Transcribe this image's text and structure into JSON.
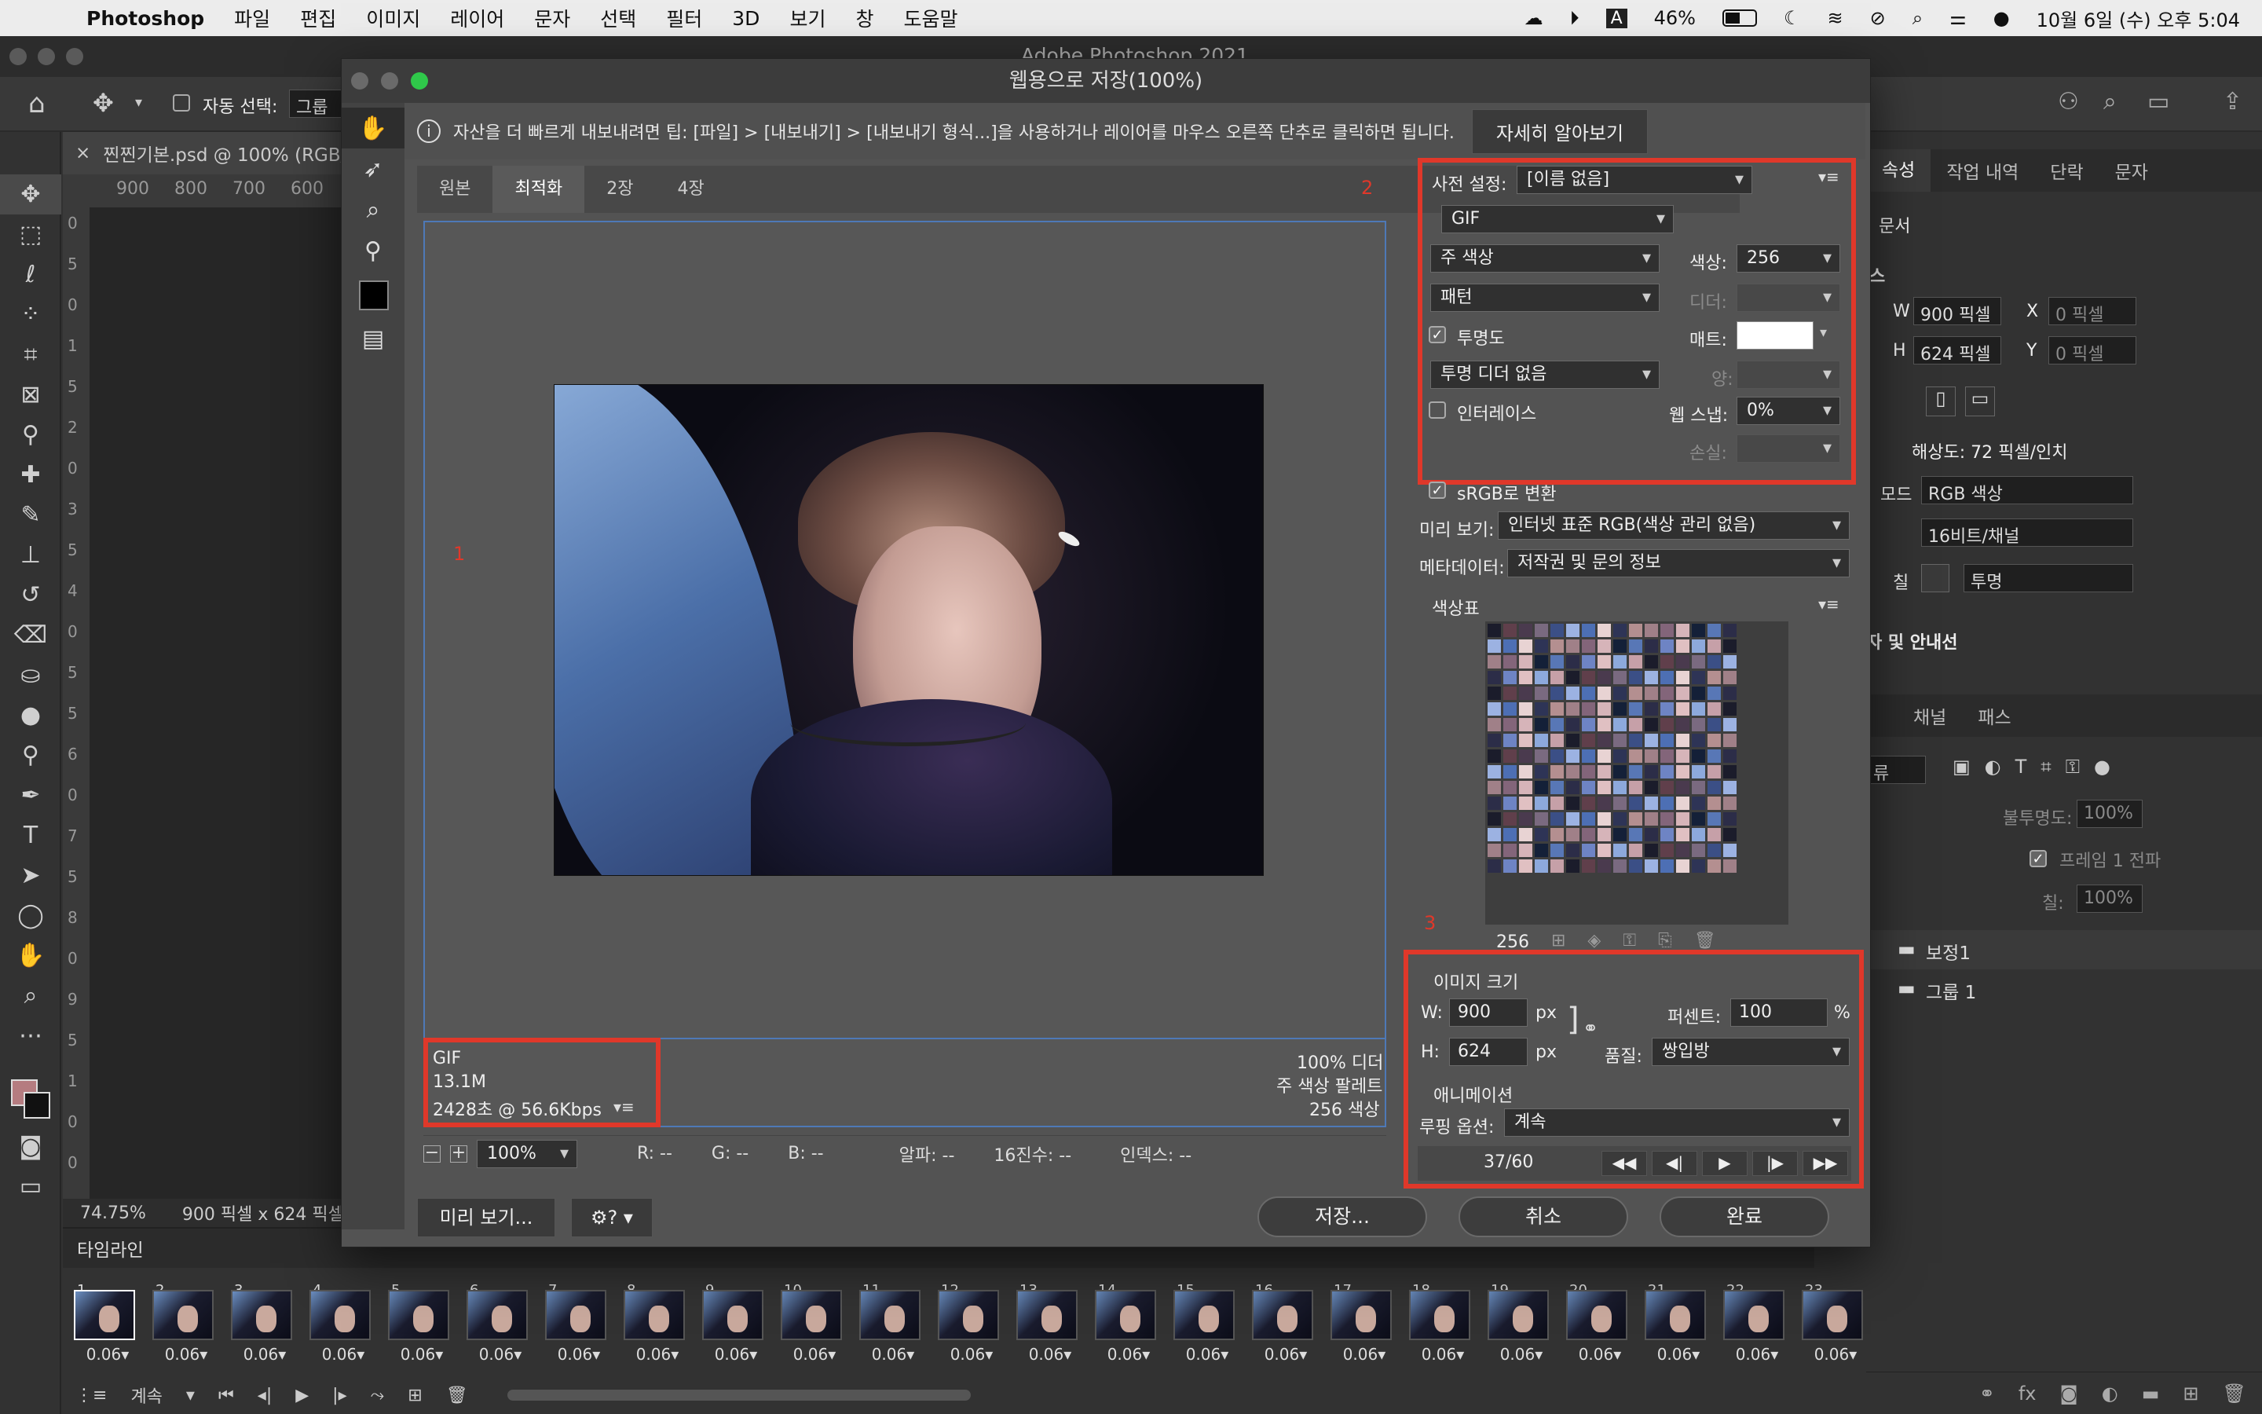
{
  "menubar": {
    "app": "Photoshop",
    "items": [
      "파일",
      "편집",
      "이미지",
      "레이어",
      "문자",
      "선택",
      "필터",
      "3D",
      "보기",
      "창",
      "도움말"
    ],
    "battery": "46%",
    "datetime": "10월 6일 (수) 오후 5:04",
    "input_icon": "A"
  },
  "ps": {
    "window_title": "Adobe Photoshop 2021",
    "options": {
      "auto_select": "자동 선택:",
      "auto_select_value": "그룹"
    },
    "doc_tab": "찐찐기본.psd @ 100% (RGB/",
    "ruler_marks": [
      "900",
      "800",
      "700",
      "600"
    ],
    "vruler_marks": [
      "0",
      "5",
      "0",
      "1",
      "5",
      "2",
      "0",
      "3",
      "5",
      "4",
      "0",
      "5",
      "5",
      "6",
      "0",
      "7",
      "5",
      "8",
      "0",
      "9",
      "5",
      "1",
      "0",
      "0"
    ],
    "status": {
      "zoom": "74.75%",
      "size": "900 픽셀 x 624 픽셀"
    }
  },
  "right_panel": {
    "tabs": [
      "속성",
      "작업 내역",
      "단락",
      "문자"
    ],
    "doc_label": "문서",
    "canvas_label": "스",
    "w_label": "W",
    "w_value": "900 픽셀",
    "x_label": "X",
    "x_value": "0 픽셀",
    "h_label": "H",
    "h_value": "624 픽셀",
    "y_label": "Y",
    "y_value": "0 픽셀",
    "resolution": "해상도: 72 픽셀/인치",
    "mode_label": "모드",
    "mode_value": "RGB 색상",
    "depth_value": "16비트/채널",
    "fill_label": "칠",
    "fill_value": "투명",
    "guides": "자 및 안내선",
    "layers_tabs": [
      "채널",
      "패스"
    ],
    "kind": "류",
    "opacity_label": "불투명도:",
    "opacity_value": "100%",
    "frame_label": "프레임 1 전파",
    "fill2_label": "칠:",
    "fill2_value": "100%",
    "layers": [
      "보정1",
      "그룹 1"
    ]
  },
  "timeline": {
    "title": "타임라인",
    "frames": [
      {
        "n": "1",
        "d": "0.06"
      },
      {
        "n": "2",
        "d": "0.06"
      },
      {
        "n": "3",
        "d": "0.06"
      },
      {
        "n": "4",
        "d": "0.06"
      },
      {
        "n": "5",
        "d": "0.06"
      },
      {
        "n": "6",
        "d": "0.06"
      },
      {
        "n": "7",
        "d": "0.06"
      },
      {
        "n": "8",
        "d": "0.06"
      },
      {
        "n": "9",
        "d": "0.06"
      },
      {
        "n": "10",
        "d": "0.06"
      },
      {
        "n": "11",
        "d": "0.06"
      },
      {
        "n": "12",
        "d": "0.06"
      },
      {
        "n": "13",
        "d": "0.06"
      },
      {
        "n": "14",
        "d": "0.06"
      },
      {
        "n": "15",
        "d": "0.06"
      },
      {
        "n": "16",
        "d": "0.06"
      },
      {
        "n": "17",
        "d": "0.06"
      },
      {
        "n": "18",
        "d": "0.06"
      },
      {
        "n": "19",
        "d": "0.06"
      },
      {
        "n": "20",
        "d": "0.06"
      },
      {
        "n": "21",
        "d": "0.06"
      },
      {
        "n": "22",
        "d": "0.06"
      },
      {
        "n": "23",
        "d": "0.06"
      }
    ],
    "loop": "계속"
  },
  "dialog": {
    "title": "웹용으로 저장(100%)",
    "tip": "자산을 더 빠르게 내보내려면 팁: [파일] > [내보내기] > [내보내기 형식...]을 사용하거나 레이어를 마우스 오른쪽 단추로 클릭하면 됩니다.",
    "learn_more": "자세히 알아보기",
    "view_tabs": [
      "원본",
      "최적화",
      "2장",
      "4장"
    ],
    "annot": {
      "a1": "1",
      "a2": "2",
      "a3": "3"
    },
    "info_left": {
      "format": "GIF",
      "size": "13.1M",
      "time": "2428초 @ 56.6Kbps"
    },
    "info_right": {
      "dither": "100% 디더",
      "palette": "주 색상 팔레트",
      "colors": "256 색상"
    },
    "zoom": "100%",
    "readout": {
      "r": "R: --",
      "g": "G: --",
      "b": "B: --",
      "alpha": "알파: --",
      "hex": "16진수: --",
      "index": "인덱스: --"
    },
    "preview_btn": "미리 보기...",
    "save_btn": "저장...",
    "cancel_btn": "취소",
    "done_btn": "완료",
    "settings": {
      "preset_label": "사전 설정:",
      "preset_value": "[이름 없음]",
      "format": "GIF",
      "reduction": "주 색상",
      "colors_label": "색상:",
      "colors_value": "256",
      "dither_algo": "패턴",
      "dither_label": "디더:",
      "transparency": "투명도",
      "matte_label": "매트:",
      "trans_dither": "투명 디더 없음",
      "amount_label": "양:",
      "interlace": "인터레이스",
      "websnap_label": "웹 스냅:",
      "websnap_value": "0%",
      "lossy_label": "손실:"
    },
    "srgb": "sRGB로 변환",
    "preview_label": "미리 보기:",
    "preview_value": "인터넷 표준 RGB(색상 관리 없음)",
    "metadata_label": "메타데이터:",
    "metadata_value": "저작권 및 문의 정보",
    "color_table_label": "색상표",
    "color_count": "256",
    "image_size": {
      "title": "이미지 크기",
      "w_label": "W:",
      "w_value": "900",
      "px1": "px",
      "h_label": "H:",
      "h_value": "624",
      "px2": "px",
      "percent_label": "퍼센트:",
      "percent_value": "100",
      "percent_unit": "%",
      "quality_label": "품질:",
      "quality_value": "쌍입방"
    },
    "animation": {
      "title": "애니메이션",
      "loop_label": "루핑 옵션:",
      "loop_value": "계속",
      "frame": "37/60"
    }
  }
}
